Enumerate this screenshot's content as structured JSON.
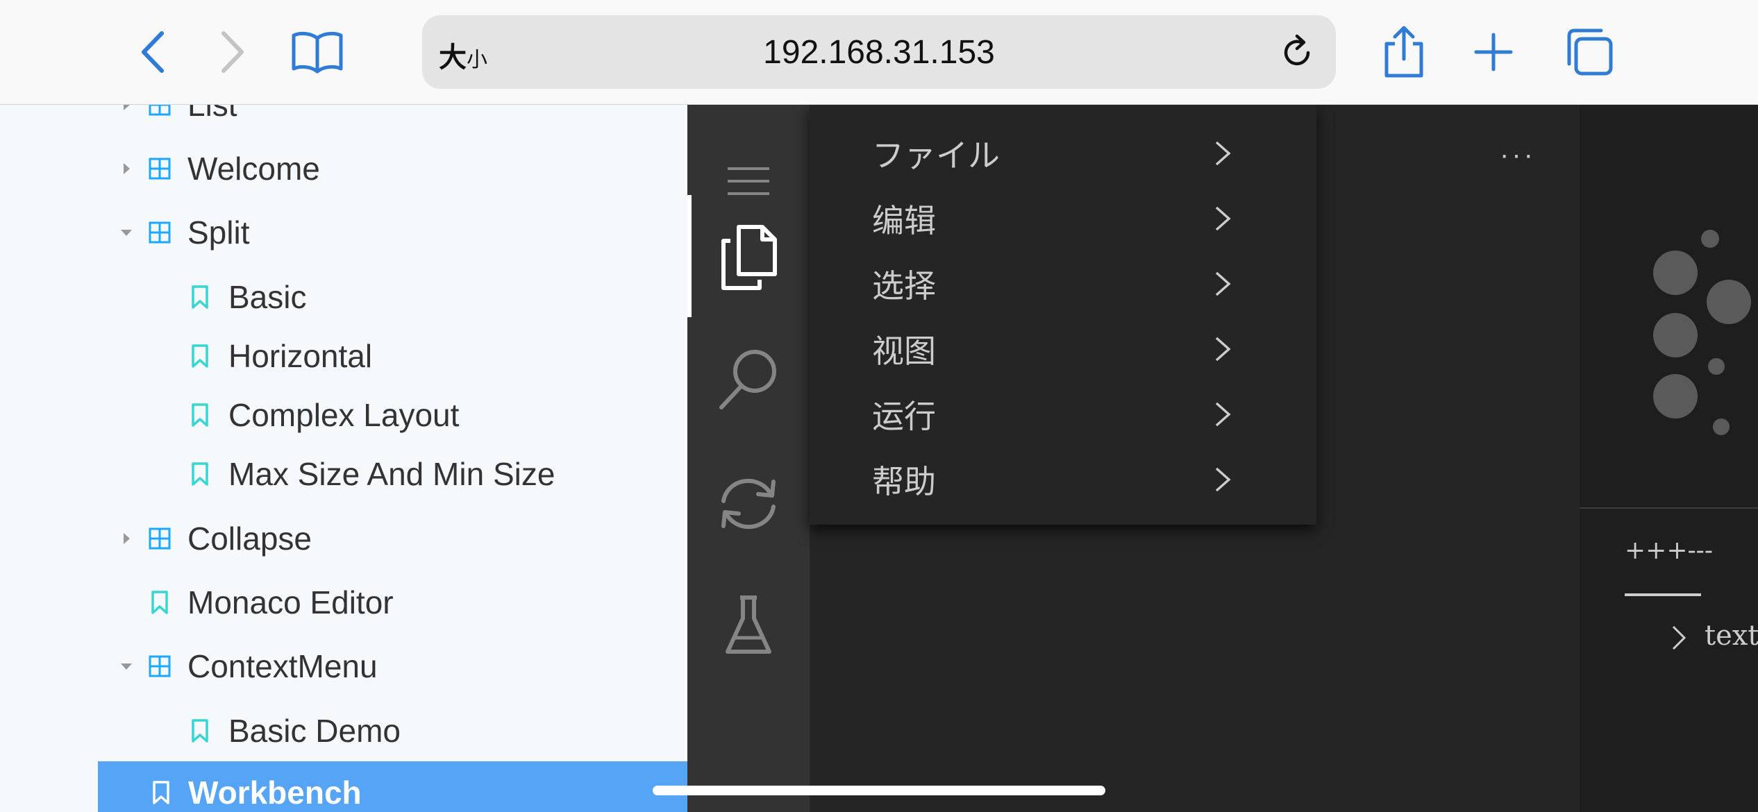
{
  "browser": {
    "text_size_label": "大",
    "text_size_small": "小",
    "url": "192.168.31.153"
  },
  "sidebar": {
    "items": [
      {
        "label": "List",
        "type": "component",
        "arrow": "right"
      },
      {
        "label": "Welcome",
        "type": "component",
        "arrow": "right"
      },
      {
        "label": "Split",
        "type": "component",
        "arrow": "down"
      },
      {
        "label": "Basic",
        "type": "story"
      },
      {
        "label": "Horizontal",
        "type": "story"
      },
      {
        "label": "Complex Layout",
        "type": "story"
      },
      {
        "label": "Max Size And Min Size",
        "type": "story"
      },
      {
        "label": "Collapse",
        "type": "component",
        "arrow": "right"
      },
      {
        "label": "Monaco Editor",
        "type": "story"
      },
      {
        "label": "ContextMenu",
        "type": "component",
        "arrow": "down"
      },
      {
        "label": "Basic Demo",
        "type": "story"
      },
      {
        "label": "Workbench",
        "type": "story",
        "selected": true
      }
    ]
  },
  "editor": {
    "menu": [
      {
        "label": "ファイル"
      },
      {
        "label": "编辑"
      },
      {
        "label": "选择"
      },
      {
        "label": "视图"
      },
      {
        "label": "运行"
      },
      {
        "label": "帮助"
      }
    ],
    "more_label": "···",
    "panel_tab": "+++---",
    "tree_row": "text"
  },
  "colors": {
    "selected_bg": "#55a4f5",
    "story_icon": "#37d5d3",
    "component_icon": "#1ea7fd",
    "ios_blue": "#2f7bd6"
  }
}
